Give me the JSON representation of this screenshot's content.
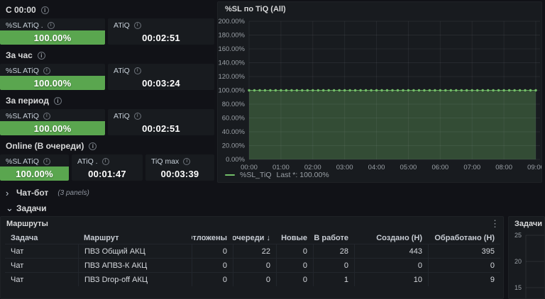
{
  "colors": {
    "green_stat": "#5aa64f",
    "green_series": "#73bf69",
    "panel_bg": "#181b1f",
    "page_bg": "#111217"
  },
  "icons": {
    "info": "i",
    "kebab": "⋮",
    "chevron_collapsed": "›",
    "chevron_expanded": "⌄"
  },
  "stat_rows": [
    {
      "label": "С 00:00",
      "panels": [
        {
          "title": "%SL ATiQ .",
          "value": "100.00%"
        },
        {
          "title": "ATiQ",
          "value": "00:02:51"
        }
      ]
    },
    {
      "label": "За час",
      "panels": [
        {
          "title": "%SL ATiQ",
          "value": "100.00%"
        },
        {
          "title": "ATiQ",
          "value": "00:03:24"
        }
      ]
    },
    {
      "label": "За период",
      "panels": [
        {
          "title": "%SL ATiQ",
          "value": "100.00%"
        },
        {
          "title": "ATiQ",
          "value": "00:02:51"
        }
      ]
    },
    {
      "label": "Online (В очереди)",
      "panels": [
        {
          "title": "%SL ATiQ",
          "value": "100.00%"
        },
        {
          "title": "ATiQ .",
          "value": "00:01:47"
        },
        {
          "title": "TiQ max",
          "value": "00:03:39"
        }
      ]
    }
  ],
  "collapsed_rows": {
    "chatbot": {
      "label": "Чат-бот",
      "count": "(3 panels)"
    },
    "tasks": {
      "label": "Задачи"
    }
  },
  "routes_table": {
    "title": "Маршруты",
    "headers": [
      "Задача",
      "Маршрут",
      "Отложены",
      "В очереди ↓",
      "Новые",
      "В работе",
      "Создано (Н)",
      "Обработано (Н)"
    ],
    "rows": [
      [
        "Чат",
        "ПВЗ Общий АКЦ",
        "0",
        "22",
        "0",
        "28",
        "443",
        "395"
      ],
      [
        "Чат",
        "ПВЗ АПВЗ-К АКЦ",
        "0",
        "0",
        "0",
        "0",
        "0",
        "0"
      ],
      [
        "Чат",
        "ПВЗ Drop-off АКЦ",
        "0",
        "0",
        "0",
        "1",
        "10",
        "9"
      ]
    ]
  },
  "chart_data": [
    {
      "type": "line",
      "title": "%SL по TiQ (All)",
      "xlabel": "",
      "ylabel": "",
      "ylim": [
        0,
        200
      ],
      "yticks": [
        "200.00%",
        "180.00%",
        "160.00%",
        "140.00%",
        "120.00%",
        "100.00%",
        "80.00%",
        "60.00%",
        "40.00%",
        "20.00%",
        "0.00%"
      ],
      "xticks": [
        "00:00",
        "01:00",
        "02:00",
        "03:00",
        "04:00",
        "05:00",
        "06:00",
        "07:00",
        "08:00",
        "09:00"
      ],
      "grid": true,
      "legend_position": "bottom",
      "legend": {
        "name": "%SL_TiQ",
        "last": "Last *: 100.00%"
      },
      "series": [
        {
          "name": "%SL_TiQ",
          "color": "#73bf69",
          "style": "points-area",
          "values": [
            100,
            100,
            100,
            100,
            100,
            100,
            100,
            100,
            100,
            100,
            100,
            100,
            100,
            100,
            100,
            100,
            100,
            100,
            100,
            100,
            100,
            100,
            100,
            100,
            100,
            100,
            100,
            100,
            100,
            100,
            100,
            100,
            100,
            100,
            100,
            100,
            100,
            100,
            100,
            100,
            100,
            100,
            100,
            100,
            100,
            100,
            100,
            100,
            100,
            100,
            100,
            100,
            100,
            100,
            100
          ]
        }
      ]
    },
    {
      "type": "line",
      "title": "Задачи (All",
      "yticks": [
        "25",
        "20",
        "15"
      ]
    }
  ]
}
